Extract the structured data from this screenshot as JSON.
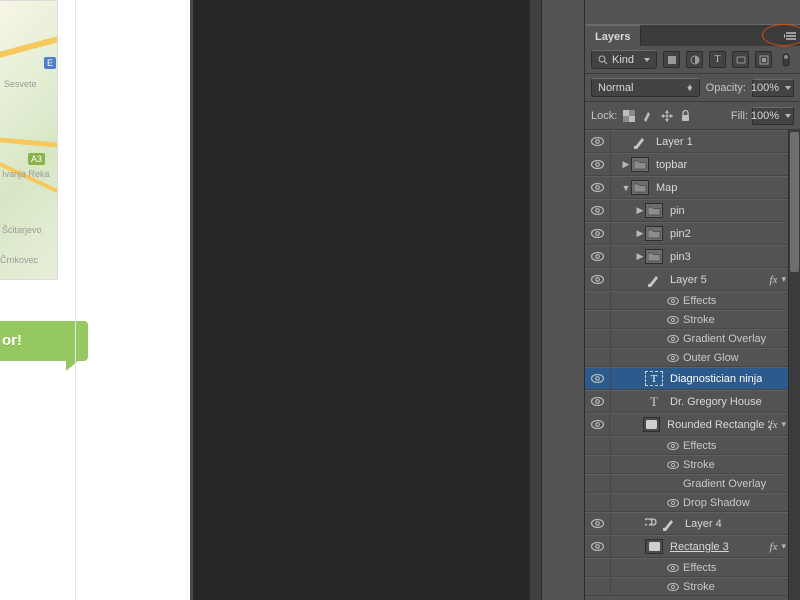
{
  "map": {
    "labels": [
      "Sesvete",
      "Ivanja Reka",
      "Šćitarjevo",
      "Črnkovec"
    ],
    "badge": "A3",
    "sign": "E"
  },
  "cta": {
    "text": "or!"
  },
  "panel": {
    "tab": "Layers",
    "filter": {
      "kind_label": "Kind",
      "icons": [
        "pixel",
        "adjust",
        "type",
        "shape",
        "smart"
      ]
    },
    "blend": {
      "mode": "Normal",
      "opacity_label": "Opacity:",
      "opacity_value": "100%"
    },
    "lock": {
      "label": "Lock:",
      "fill_label": "Fill:",
      "fill_value": "100%"
    }
  },
  "layers": [
    {
      "kind": "brush",
      "name": "Layer 1",
      "depth": 0
    },
    {
      "kind": "folder",
      "name": "topbar",
      "depth": 0,
      "tw": "▶"
    },
    {
      "kind": "folder",
      "name": "Map",
      "depth": 0,
      "tw": "▼",
      "open": true
    },
    {
      "kind": "folder",
      "name": "pin",
      "depth": 1,
      "tw": "▶"
    },
    {
      "kind": "folder",
      "name": "pin2",
      "depth": 1,
      "tw": "▶"
    },
    {
      "kind": "folder",
      "name": "pin3",
      "depth": 1,
      "tw": "▶"
    },
    {
      "kind": "brush",
      "name": "Layer 5",
      "depth": 1,
      "fx": true,
      "fxopen": true,
      "effects": [
        "Effects",
        "Stroke",
        "Gradient Overlay",
        "Outer Glow"
      ]
    },
    {
      "kind": "textsel",
      "name": "Diagnostician ninja",
      "depth": 1,
      "selected": true
    },
    {
      "kind": "text",
      "name": "Dr. Gregory House",
      "depth": 1
    },
    {
      "kind": "shape",
      "name": "Rounded Rectangle 2",
      "depth": 1,
      "fx": true,
      "fxopen": true,
      "effects": [
        "Effects",
        "Stroke",
        "Gradient Overlay",
        "Drop Shadow"
      ]
    },
    {
      "kind": "brush",
      "name": "Layer 4",
      "depth": 1,
      "linked": true
    },
    {
      "kind": "shape",
      "name": "Rectangle 3",
      "depth": 1,
      "fx": true,
      "fxopen": true,
      "underline": true,
      "effects": [
        "Effects",
        "Stroke"
      ]
    }
  ],
  "effect_eye_hidden": [
    "Gradient Overlay"
  ]
}
